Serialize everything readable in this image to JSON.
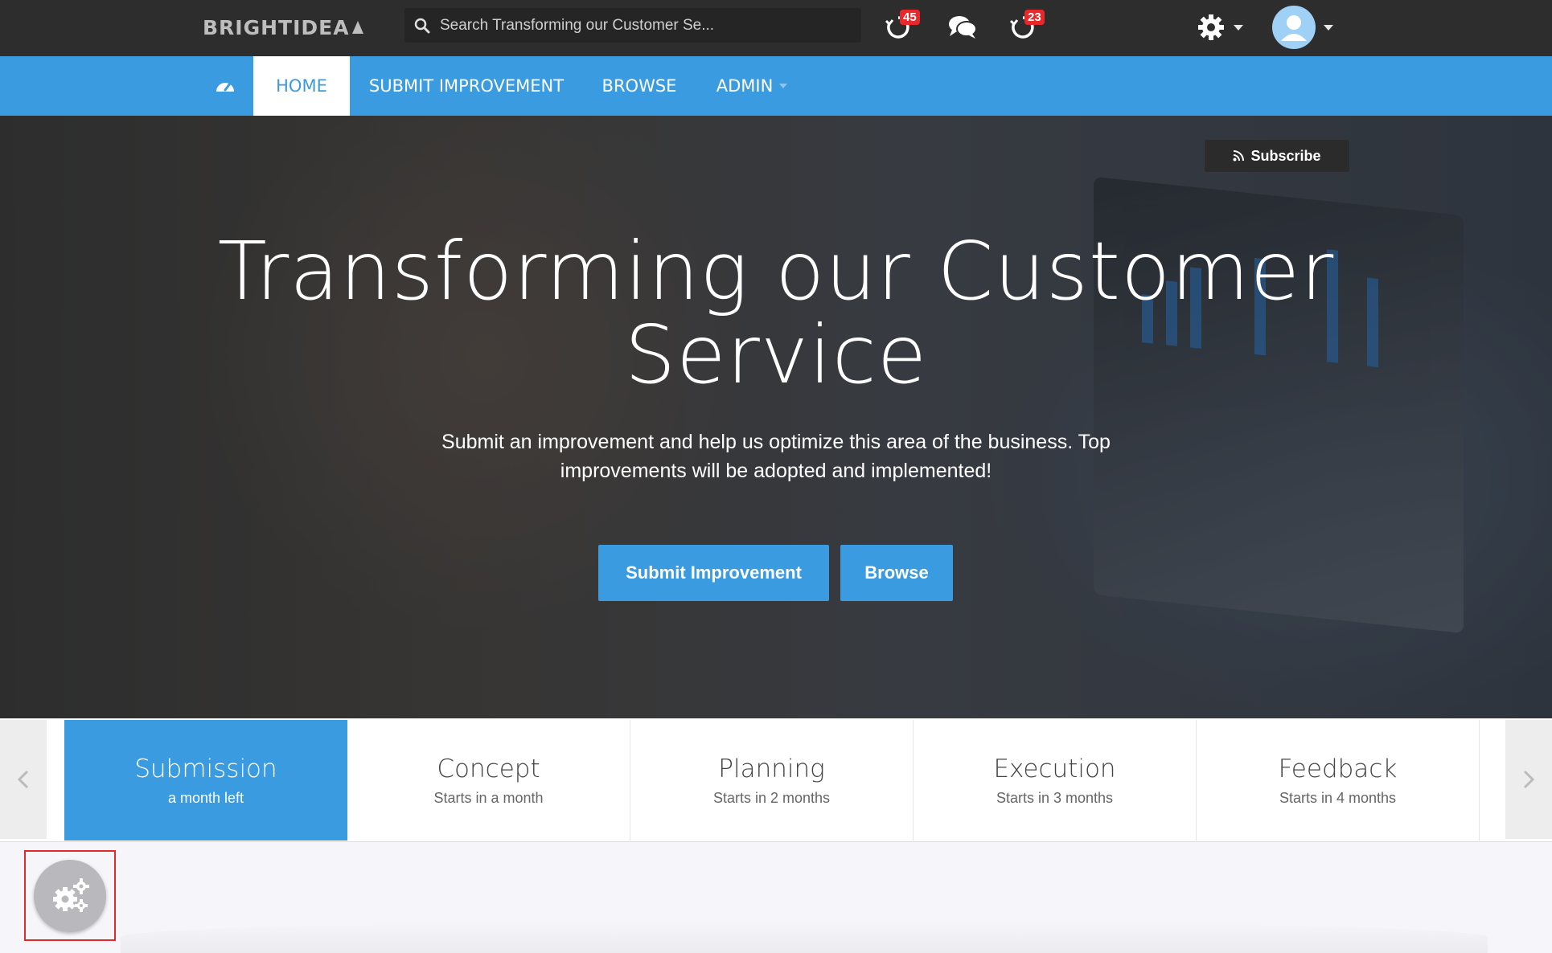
{
  "header": {
    "logo_text": "BRIGHTIDEA",
    "search": {
      "placeholder": "Search Transforming our Customer Se..."
    },
    "notifications": {
      "badge": "45"
    },
    "activity": {
      "badge": "23"
    }
  },
  "nav": {
    "items": [
      {
        "label": "HOME"
      },
      {
        "label": "SUBMIT IMPROVEMENT"
      },
      {
        "label": "BROWSE"
      },
      {
        "label": "ADMIN"
      }
    ]
  },
  "hero": {
    "subscribe_label": "Subscribe",
    "title_line1": "Transforming our Customer",
    "title_line2": "Service",
    "subtitle": "Submit an improvement and help us optimize this area of the business. Top improvements will be adopted and implemented!",
    "submit_button": "Submit Improvement",
    "browse_button": "Browse"
  },
  "phases": [
    {
      "name": "Submission",
      "time": "a month left",
      "active": true
    },
    {
      "name": "Concept",
      "time": "Starts in a month"
    },
    {
      "name": "Planning",
      "time": "Starts in 2 months"
    },
    {
      "name": "Execution",
      "time": "Starts in 3 months"
    },
    {
      "name": "Feedback",
      "time": "Starts in 4 months"
    }
  ],
  "colors": {
    "accent": "#3a9be0",
    "topbar": "#2d2d2d",
    "badge": "#e8282b",
    "highlight_box": "#e02b2b"
  }
}
